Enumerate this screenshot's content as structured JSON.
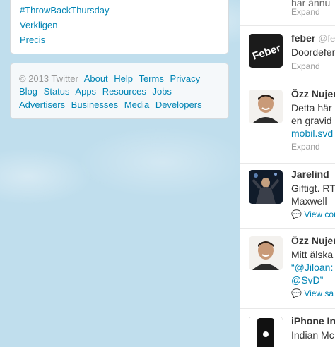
{
  "trends": [
    "#ThrowBackThursday",
    "Verkligen",
    "Precis"
  ],
  "footer": {
    "row1": [
      "© 2013 Twitter",
      "About",
      "Help",
      "Terms",
      "Privacy"
    ],
    "row2": [
      "Blog",
      "Status",
      "Apps",
      "Resources",
      "Jobs"
    ],
    "row3": [
      "Advertisers",
      "Businesses",
      "Media",
      "Developers"
    ]
  },
  "stream": {
    "top_partial_text": "har ännu",
    "expand_label": "Expand",
    "tweets": [
      {
        "name": "feber",
        "handle": "@feb",
        "line1": "Doordefen",
        "action": "Expand",
        "avatar_text": "Feber"
      },
      {
        "name": "Özz Nujen",
        "line1": "Detta här",
        "line2": "en gravid",
        "line3": "mobil.svd",
        "action": "Expand"
      },
      {
        "name": "Jarelind",
        "line1": "Giftigt. RT",
        "line2": "Maxwell –",
        "action": "View con"
      },
      {
        "name": "Özz Nujen",
        "line1": "Mitt älska",
        "line2": "“@Jiloan:",
        "line3": "@SvD”",
        "action": "View sa"
      },
      {
        "name": "iPhone In",
        "line1": "Indian Mc"
      }
    ]
  },
  "colors": {
    "link": "#0084b4",
    "background": "#c0deed"
  }
}
